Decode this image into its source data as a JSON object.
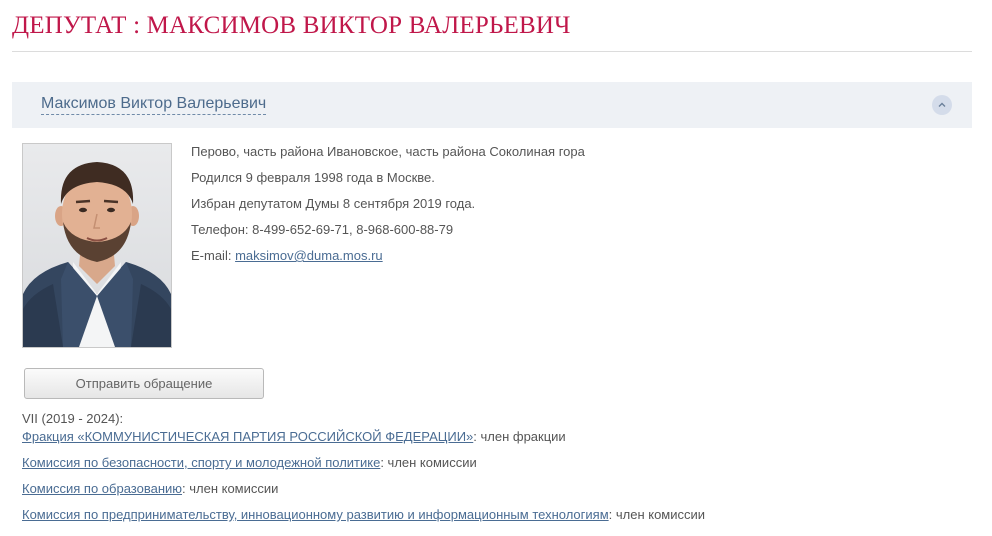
{
  "page": {
    "title": "ДЕПУТАТ : МАКСИМОВ ВИКТОР ВАЛЕРЬЕВИЧ"
  },
  "deputy": {
    "name": "Максимов Виктор Валерьевич",
    "district": "Перово, часть района Ивановское, часть района Соколиная гора",
    "born": "Родился 9 февраля 1998 года в Москве.",
    "elected": "Избран депутатом Думы 8 сентября 2019 года.",
    "phone": "Телефон: 8-499-652-69-71, 8-968-600-88-79",
    "email_label": "E-mail:",
    "email": "maksimov@duma.mos.ru"
  },
  "actions": {
    "send_appeal_label": "Отправить обращение"
  },
  "convocation": {
    "label": "VII (2019 - 2024):",
    "memberships": [
      {
        "name": "Фракция «КОММУНИСТИЧЕСКАЯ ПАРТИЯ РОССИЙСКОЙ ФЕДЕРАЦИИ»",
        "role": ": член фракции"
      },
      {
        "name": "Комиссия по безопасности, спорту и молодежной политике",
        "role": ": член комиссии"
      },
      {
        "name": "Комиссия по образованию",
        "role": ": член комиссии"
      },
      {
        "name": "Комиссия по предпринимательству, инновационному развитию и информационным технологиям",
        "role": ": член комиссии"
      }
    ]
  },
  "colors": {
    "title": "#c0174a",
    "link": "#4a6c93",
    "accordion_bg": "#eef1f5"
  },
  "icons": {
    "toggle": "chevron-up-icon"
  }
}
